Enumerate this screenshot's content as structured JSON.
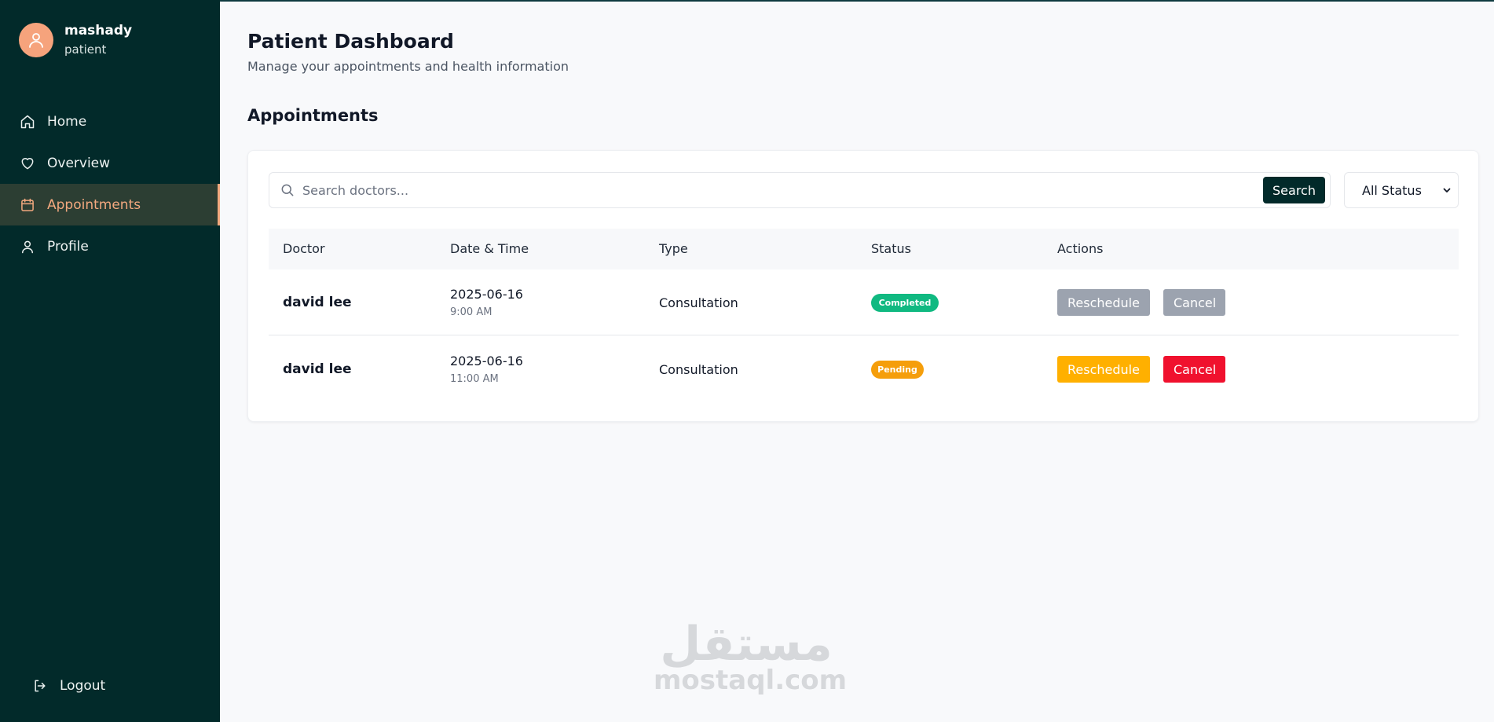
{
  "user": {
    "name": "mashady",
    "role": "patient"
  },
  "nav": {
    "items": [
      {
        "label": "Home",
        "icon": "home-icon"
      },
      {
        "label": "Overview",
        "icon": "heart-icon"
      },
      {
        "label": "Appointments",
        "icon": "calendar-icon",
        "active": true
      },
      {
        "label": "Profile",
        "icon": "user-icon"
      }
    ],
    "logout_label": "Logout"
  },
  "header": {
    "title": "Patient Dashboard",
    "subtitle": "Manage your appointments and health information"
  },
  "appointments": {
    "section_title": "Appointments",
    "search": {
      "placeholder": "Search doctors...",
      "value": "",
      "button_label": "Search"
    },
    "status_filter": {
      "selected": "All Status"
    },
    "columns": [
      "Doctor",
      "Date & Time",
      "Type",
      "Status",
      "Actions"
    ],
    "rows": [
      {
        "doctor": "david lee",
        "date": "2025-06-16",
        "time": "9:00 AM",
        "type": "Consultation",
        "status": "Completed",
        "reschedule_label": "Reschedule",
        "cancel_label": "Cancel"
      },
      {
        "doctor": "david lee",
        "date": "2025-06-16",
        "time": "11:00 AM",
        "type": "Consultation",
        "status": "Pending",
        "reschedule_label": "Reschedule",
        "cancel_label": "Cancel"
      }
    ]
  },
  "colors": {
    "sidebar_bg": "#022a2a",
    "accent": "#f3a97f",
    "completed": "#10b981",
    "pending": "#f59e0b",
    "reschedule_active": "#ffb000",
    "cancel_active": "#f0112e",
    "disabled_button": "#9ca3af"
  },
  "watermark": {
    "arabic": "مستقل",
    "latin": "mostaql.com"
  }
}
